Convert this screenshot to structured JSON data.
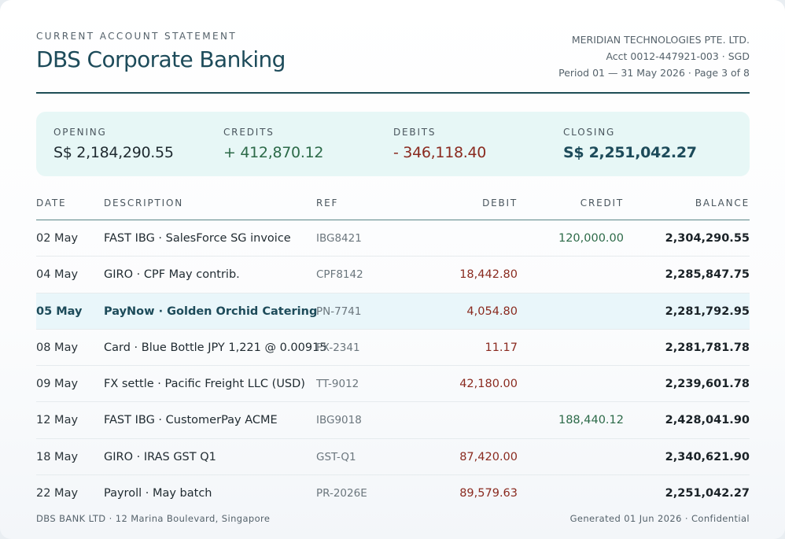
{
  "header": {
    "eyebrow": "CURRENT ACCOUNT STATEMENT",
    "title": "DBS Corporate Banking",
    "company": "MERIDIAN TECHNOLOGIES PTE. LTD.",
    "account": "Acct 0012-447921-003 · SGD",
    "period": "Period 01 — 31 May 2026 · Page 3 of 8"
  },
  "summary": {
    "opening": {
      "label": "OPENING",
      "value": "S$ 2,184,290.55"
    },
    "credits": {
      "label": "CREDITS",
      "value": "+ 412,870.12"
    },
    "debits": {
      "label": "DEBITS",
      "value": "- 346,118.40"
    },
    "closing": {
      "label": "CLOSING",
      "value": "S$ 2,251,042.27"
    }
  },
  "table": {
    "columns": [
      "DATE",
      "DESCRIPTION",
      "REF",
      "DEBIT",
      "CREDIT",
      "BALANCE"
    ],
    "rows": [
      {
        "date": "02 May",
        "desc": "FAST IBG · SalesForce SG invoice",
        "ref": "IBG8421",
        "debit": "",
        "credit": "120,000.00",
        "balance": "2,304,290.55"
      },
      {
        "date": "04 May",
        "desc": "GIRO · CPF May contrib.",
        "ref": "CPF8142",
        "debit": "18,442.80",
        "credit": "",
        "balance": "2,285,847.75"
      },
      {
        "date": "05 May",
        "desc": "PayNow · Golden Orchid Catering",
        "ref": "PN-7741",
        "debit": "4,054.80",
        "credit": "",
        "balance": "2,281,792.95"
      },
      {
        "date": "08 May",
        "desc": "Card · Blue Bottle JPY 1,221 @ 0.00915",
        "ref": "FX-2341",
        "debit": "11.17",
        "credit": "",
        "balance": "2,281,781.78"
      },
      {
        "date": "09 May",
        "desc": "FX settle · Pacific Freight LLC (USD)",
        "ref": "TT-9012",
        "debit": "42,180.00",
        "credit": "",
        "balance": "2,239,601.78"
      },
      {
        "date": "12 May",
        "desc": "FAST IBG · CustomerPay ACME",
        "ref": "IBG9018",
        "debit": "",
        "credit": "188,440.12",
        "balance": "2,428,041.90"
      },
      {
        "date": "18 May",
        "desc": "GIRO · IRAS GST Q1",
        "ref": "GST-Q1",
        "debit": "87,420.00",
        "credit": "",
        "balance": "2,340,621.90"
      },
      {
        "date": "22 May",
        "desc": "Payroll · May batch",
        "ref": "PR-2026E",
        "debit": "89,579.63",
        "credit": "",
        "balance": "2,251,042.27"
      }
    ]
  },
  "footer": {
    "left": "DBS BANK LTD · 12 Marina Boulevard, Singapore",
    "right": "Generated 01 Jun 2026 · Confidential"
  },
  "colors": {
    "accent": "#1d4b5a",
    "credit": "#2c6a48",
    "debit": "#8a2a1f",
    "summary_bg": "#e7f7f6",
    "highlight_row": "#e9f6fa"
  }
}
